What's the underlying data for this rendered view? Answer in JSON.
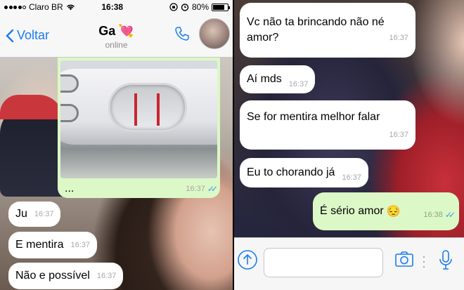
{
  "left_screen": {
    "status_bar": {
      "carrier": "Claro BR",
      "time": "16:38",
      "battery": "80%",
      "battery_level": 0.8
    },
    "nav": {
      "back_label": "Voltar",
      "contact_name": "Ga",
      "contact_emoji": "💘",
      "contact_status": "online"
    },
    "image_message": {
      "caption": "...",
      "time": "16:37"
    },
    "messages": [
      {
        "text": "Ju",
        "time": "16:37"
      },
      {
        "text": "E mentira",
        "time": "16:37"
      },
      {
        "text": "Não e possível",
        "time": "16:37"
      }
    ]
  },
  "right_screen": {
    "messages": [
      {
        "text_line1": "Vc não ta brincando não né",
        "text_line2": "amor?",
        "time": "16:37"
      },
      {
        "text": "Aí mds",
        "time": "16:37"
      },
      {
        "text": "Se for mentira melhor falar",
        "time": "16:37"
      },
      {
        "text": "Eu to chorando já",
        "time": "16:37"
      },
      {
        "text": "É sério amor",
        "emoji": "😔",
        "time": "16:38"
      }
    ]
  },
  "icons": [
    "back-chevron-icon",
    "phone-icon",
    "upload-icon",
    "camera-icon",
    "microphone-icon",
    "double-check-icon",
    "wifi-icon",
    "alarm-icon",
    "lock-rotation-icon"
  ],
  "colors": {
    "ios_blue": "#1a7cf2",
    "incoming_bubble": "#ffffff",
    "outgoing_bubble": "#dcf8c6",
    "read_ticks": "#3e9be8"
  }
}
